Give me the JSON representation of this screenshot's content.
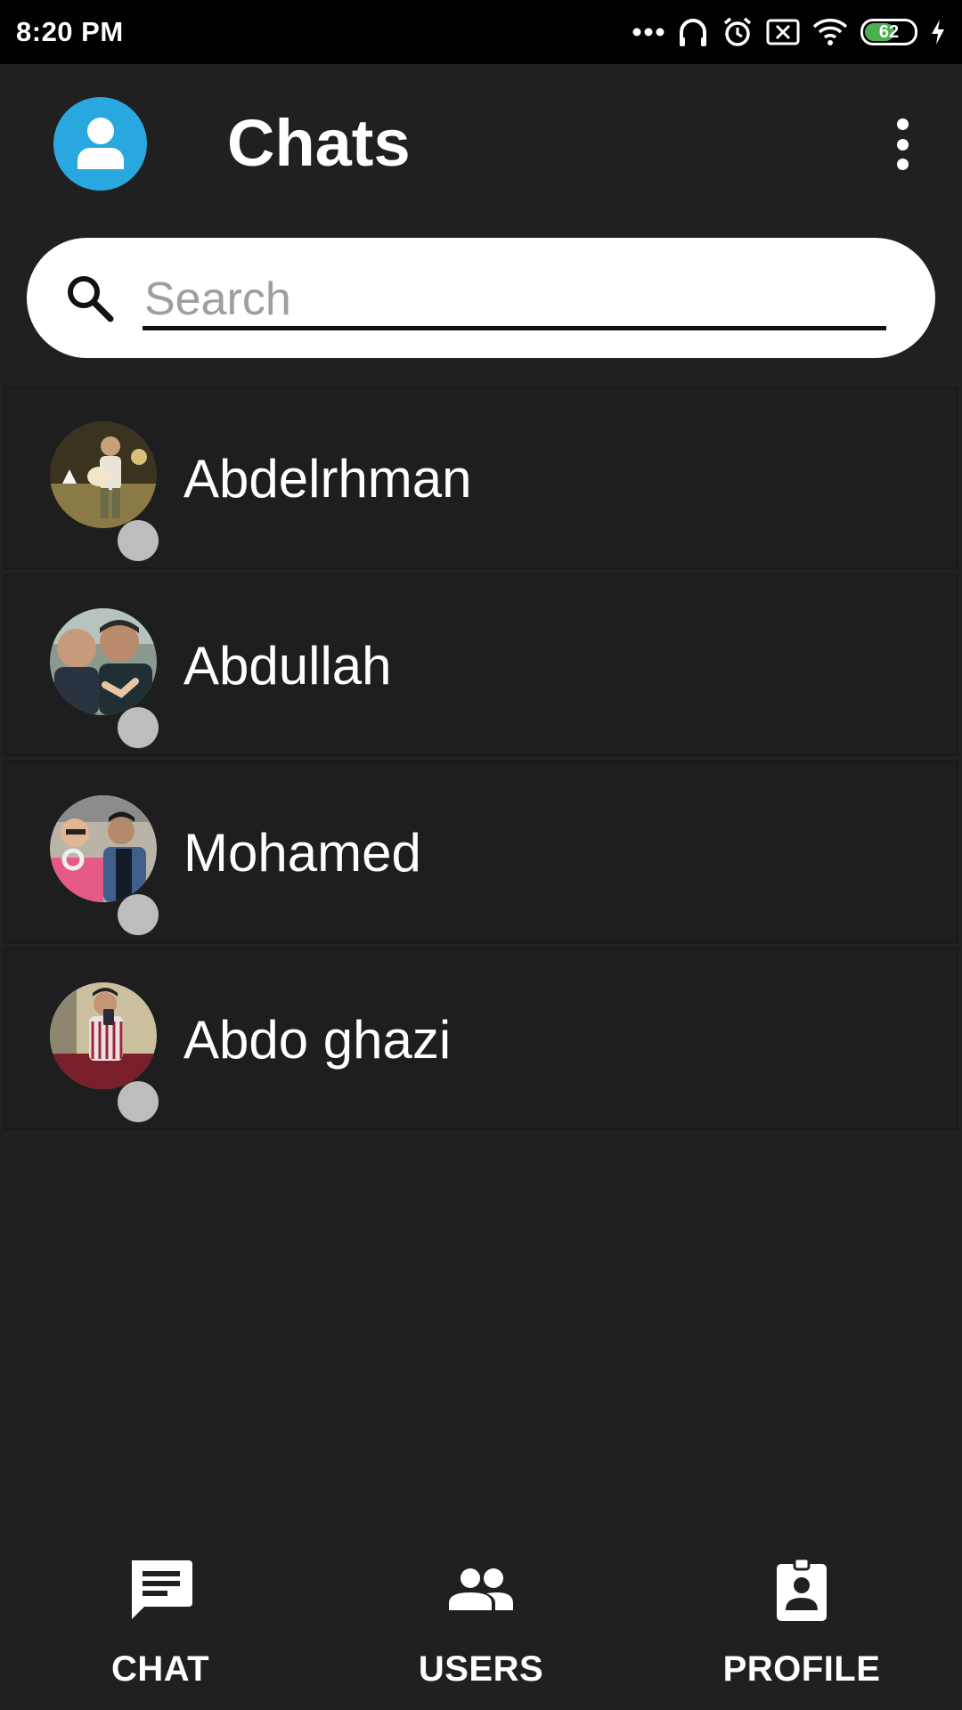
{
  "status_bar": {
    "time": "8:20 PM",
    "battery_level": "62",
    "icons": [
      "more-dots-icon",
      "headphones-icon",
      "alarm-icon",
      "sim-off-icon",
      "wifi-icon",
      "battery-icon",
      "charging-icon"
    ]
  },
  "header": {
    "title": "Chats",
    "avatar_icon": "person-icon",
    "menu_icon": "more-vertical-icon",
    "avatar_color": "#29a8e0"
  },
  "search": {
    "placeholder": "Search",
    "value": "",
    "icon": "search-icon"
  },
  "chats": [
    {
      "name": "Abdelrhman",
      "status": "offline"
    },
    {
      "name": "Abdullah",
      "status": "offline"
    },
    {
      "name": "Mohamed",
      "status": "offline"
    },
    {
      "name": "Abdo ghazi",
      "status": "offline"
    }
  ],
  "bottom_nav": {
    "items": [
      {
        "label": "CHAT",
        "icon": "chat-icon"
      },
      {
        "label": "USERS",
        "icon": "users-icon"
      },
      {
        "label": "PROFILE",
        "icon": "profile-badge-icon"
      }
    ]
  },
  "colors": {
    "background": "#202020",
    "status_bar": "#000000",
    "presence_offline": "#bdbdbd",
    "battery_fill": "#4caf50"
  }
}
